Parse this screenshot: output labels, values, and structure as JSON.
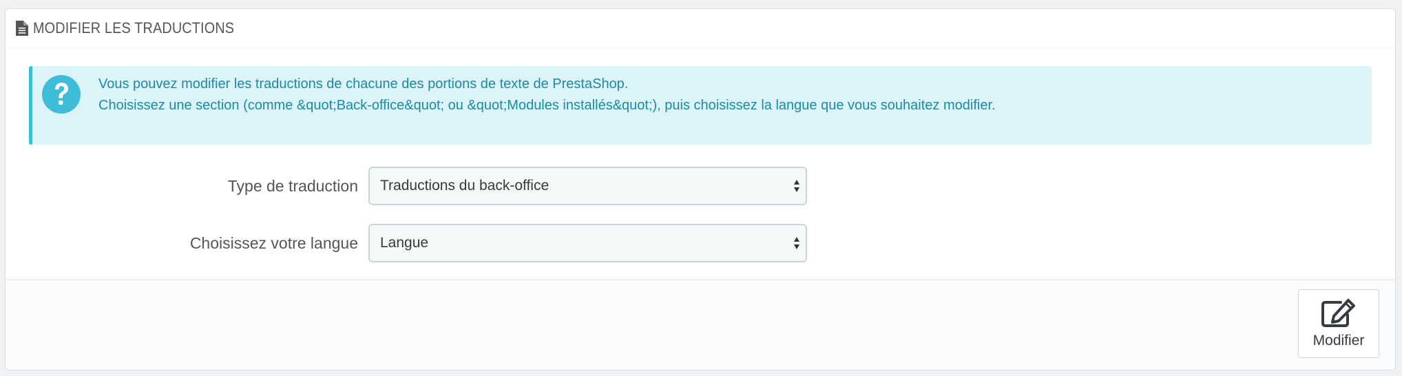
{
  "panel": {
    "title": "MODIFIER LES TRADUCTIONS",
    "icon": "document-icon"
  },
  "alert": {
    "icon": "question-circle-icon",
    "line1": "Vous pouvez modifier les traductions de chacune des portions de texte de PrestaShop.",
    "line2": "Choisissez une section (comme &quot;Back-office&quot; ou &quot;Modules installés&quot;), puis choisissez la langue que vous souhaitez modifier."
  },
  "form": {
    "type_label": "Type de traduction",
    "type_value": "Traductions du back-office",
    "lang_label": "Choisissez votre langue",
    "lang_value": "Langue"
  },
  "footer": {
    "submit_label": "Modifier",
    "submit_icon": "edit-icon"
  },
  "colors": {
    "alert_bg": "#dcf3f8",
    "alert_border": "#3ebdd9",
    "alert_text": "#1b8aa5"
  }
}
